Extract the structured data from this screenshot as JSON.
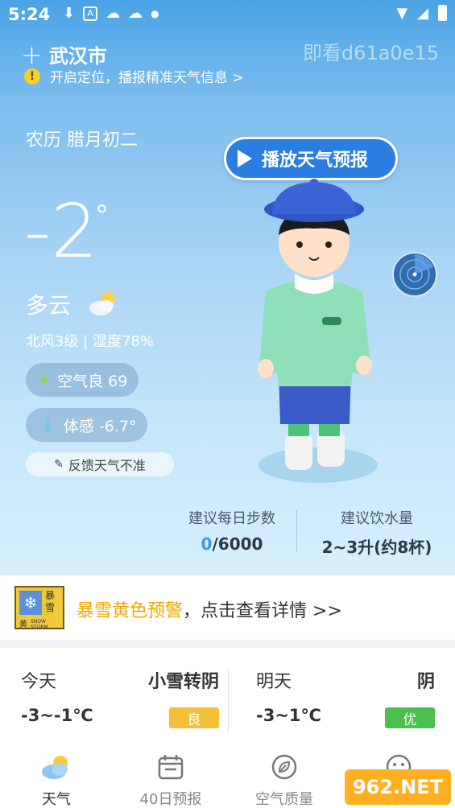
{
  "status_bar": {
    "time": "5:24",
    "icons": [
      "download-icon",
      "a-icon",
      "cloud-sun-icon",
      "cloud-icon",
      "dot-icon"
    ],
    "right_icons": [
      "wifi-icon",
      "signal-icon",
      "battery-icon"
    ]
  },
  "header": {
    "city": "武汉市",
    "watermark": "即看d61a0e15",
    "locate_text": "开启定位，播报精准天气信息 >"
  },
  "current": {
    "lunar": "农历 腊月初二",
    "temp": "-2",
    "degree": "°",
    "condition": "多云",
    "wind_humidity": "北风3级 | 湿度78%",
    "air_quality": "空气良 69",
    "feels_like": "体感 -6.7°",
    "feedback": "反馈天气不准"
  },
  "play_button": "播放天气预报",
  "stats": {
    "steps_label": "建议每日步数",
    "steps_current": "0",
    "steps_target": "/6000",
    "water_label": "建议饮水量",
    "water_value": "2~3升(约8杯)"
  },
  "alert": {
    "badge_top": "暴雪",
    "badge_bottom": "黄",
    "badge_en": "SNOW STORM",
    "level_text": "暴雪黄色预警",
    "rest_text": "，点击查看详情 >>"
  },
  "forecast": [
    {
      "day": "今天",
      "condition": "小雪转阴",
      "temp": "-3~-1℃",
      "aqi": "良",
      "aqi_color": "#f5bf3a"
    },
    {
      "day": "明天",
      "condition": "阴",
      "temp": "-3~1℃",
      "aqi": "优",
      "aqi_color": "#4cbf4c"
    }
  ],
  "tabs": [
    {
      "label": "天气",
      "icon": "weather-icon",
      "active": true
    },
    {
      "label": "40日预报",
      "icon": "calendar-icon",
      "active": false
    },
    {
      "label": "空气质量",
      "icon": "leaf-icon",
      "active": false
    },
    {
      "label": "我的",
      "icon": "smile-icon",
      "active": false
    }
  ],
  "corner_logo": "962.NET",
  "colors": {
    "accent": "#2a7de1",
    "alert_yellow": "#f0a800"
  }
}
